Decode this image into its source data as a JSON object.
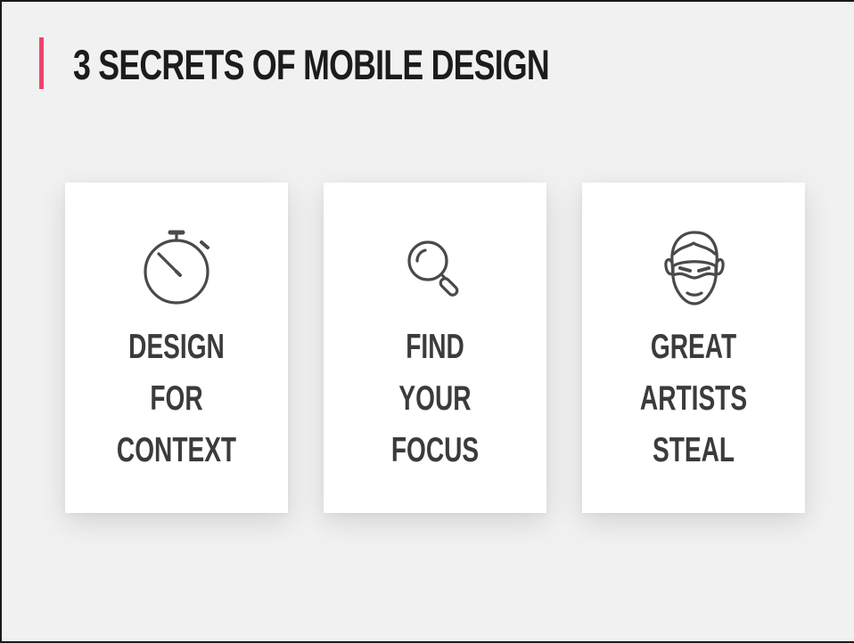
{
  "slide": {
    "title": "3 SECRETS OF MOBILE DESIGN",
    "accent_color": "#f2416b"
  },
  "cards": [
    {
      "icon": "stopwatch-icon",
      "lines": [
        "DESIGN",
        "FOR",
        "CONTEXT"
      ]
    },
    {
      "icon": "magnifier-icon",
      "lines": [
        "FIND",
        "YOUR",
        "FOCUS"
      ]
    },
    {
      "icon": "masked-face-icon",
      "lines": [
        "GREAT",
        "ARTISTS",
        "STEAL"
      ]
    }
  ]
}
